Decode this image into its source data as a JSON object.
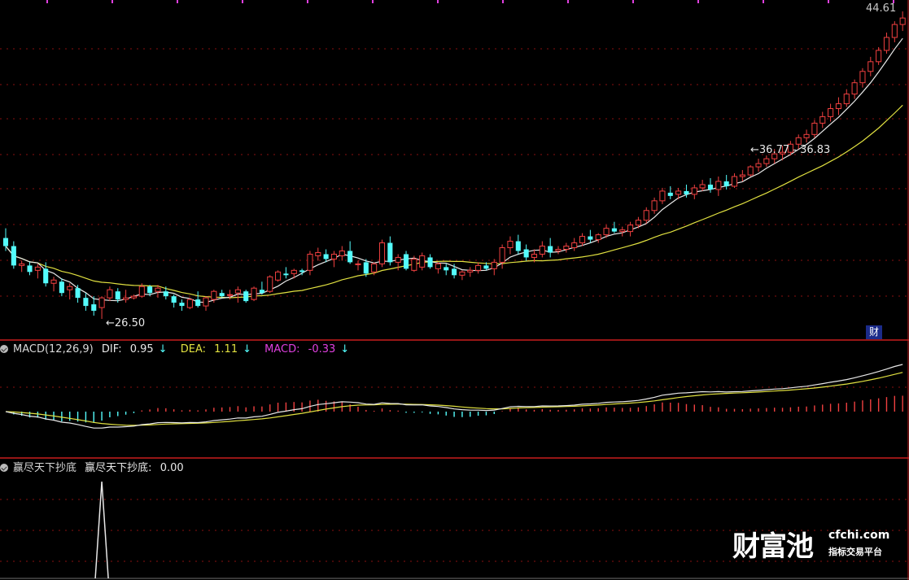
{
  "colors": {
    "up": "#f04040",
    "down": "#54fcfc",
    "ma_short": "#e8e8e8",
    "ma_long": "#e0e040",
    "dif": "#e8e8e8",
    "dea": "#e0e040",
    "grid": "#8a1010",
    "divider": "#c81e1e",
    "magenta": "#e040e0"
  },
  "price_panel": {
    "top_label": "44.61",
    "low_label": "26.50",
    "range_label": "36.77 - 36.83",
    "corner_badge": "财"
  },
  "macd_panel": {
    "name": "MACD(12,26,9)",
    "dif_label": "DIF:",
    "dif_value": "0.95",
    "dif_arrow": "↓",
    "dea_label": "DEA:",
    "dea_value": "1.11",
    "dea_arrow": "↓",
    "macd_label": "MACD:",
    "macd_value": "-0.33",
    "macd_arrow": "↓"
  },
  "signal_panel": {
    "name": "赢尽天下抄底",
    "series_label": "赢尽天下抄底:",
    "series_value": "0.00"
  },
  "brand": {
    "main": "财富池",
    "domain": "cfchi.com",
    "slogan": "指标交易平台"
  },
  "chart_data": [
    {
      "type": "candlestick",
      "y_top_label": 44.61,
      "y_low_marker": 26.5,
      "ohlc": [
        [
          30.6,
          31.2,
          29.8,
          30.1
        ],
        [
          30.1,
          30.4,
          28.7,
          28.9
        ],
        [
          28.9,
          29.2,
          28.5,
          29.0
        ],
        [
          28.9,
          29.1,
          28.3,
          28.5
        ],
        [
          28.6,
          29.0,
          28.1,
          28.8
        ],
        [
          28.7,
          29.1,
          27.6,
          27.8
        ],
        [
          27.8,
          28.2,
          27.3,
          28.0
        ],
        [
          27.9,
          28.1,
          27.0,
          27.2
        ],
        [
          27.4,
          27.8,
          26.8,
          27.6
        ],
        [
          27.5,
          27.7,
          26.6,
          26.9
        ],
        [
          26.9,
          27.2,
          26.1,
          26.4
        ],
        [
          26.5,
          27.0,
          25.8,
          26.1
        ],
        [
          26.3,
          27.0,
          25.6,
          26.9
        ],
        [
          26.9,
          27.6,
          26.7,
          27.4
        ],
        [
          27.3,
          27.5,
          26.6,
          26.8
        ],
        [
          26.8,
          27.4,
          26.6,
          26.9
        ],
        [
          26.9,
          27.1,
          26.8,
          27.0
        ],
        [
          27.0,
          27.8,
          26.9,
          27.6
        ],
        [
          27.6,
          27.7,
          27.0,
          27.2
        ],
        [
          27.3,
          27.7,
          26.9,
          27.5
        ],
        [
          27.3,
          27.6,
          26.8,
          27.0
        ],
        [
          27.0,
          27.1,
          26.3,
          26.6
        ],
        [
          26.6,
          26.8,
          26.1,
          26.4
        ],
        [
          26.3,
          26.9,
          26.2,
          26.8
        ],
        [
          26.8,
          27.3,
          26.3,
          26.4
        ],
        [
          26.4,
          27.0,
          26.1,
          26.9
        ],
        [
          26.8,
          27.4,
          26.6,
          27.3
        ],
        [
          27.2,
          27.4,
          26.9,
          27.0
        ],
        [
          27.1,
          27.4,
          26.8,
          27.1
        ],
        [
          27.2,
          27.6,
          26.6,
          27.4
        ],
        [
          27.3,
          27.4,
          26.6,
          26.7
        ],
        [
          26.8,
          27.6,
          26.7,
          27.5
        ],
        [
          27.4,
          27.9,
          27.1,
          27.2
        ],
        [
          27.3,
          28.3,
          27.2,
          28.2
        ],
        [
          28.0,
          28.6,
          27.9,
          28.5
        ],
        [
          28.4,
          28.8,
          28.1,
          28.3
        ],
        [
          28.4,
          28.7,
          28.1,
          28.6
        ],
        [
          28.6,
          28.7,
          28.3,
          28.5
        ],
        [
          28.6,
          29.8,
          28.3,
          29.6
        ],
        [
          29.5,
          30.0,
          29.2,
          29.7
        ],
        [
          29.6,
          29.9,
          29.1,
          29.3
        ],
        [
          29.3,
          29.8,
          28.8,
          29.6
        ],
        [
          29.5,
          30.1,
          29.2,
          29.8
        ],
        [
          29.8,
          30.4,
          29.0,
          29.1
        ],
        [
          29.0,
          29.2,
          28.6,
          29.0
        ],
        [
          29.1,
          29.3,
          28.2,
          28.4
        ],
        [
          28.5,
          29.1,
          28.3,
          29.0
        ],
        [
          29.0,
          30.5,
          28.8,
          30.3
        ],
        [
          30.3,
          30.7,
          28.9,
          29.1
        ],
        [
          29.1,
          29.6,
          28.6,
          29.4
        ],
        [
          29.6,
          29.8,
          28.6,
          28.7
        ],
        [
          28.6,
          29.5,
          28.5,
          29.3
        ],
        [
          28.8,
          29.7,
          28.6,
          29.5
        ],
        [
          29.4,
          29.6,
          28.7,
          28.8
        ],
        [
          28.7,
          29.1,
          28.4,
          29.0
        ],
        [
          28.8,
          29.0,
          28.3,
          28.6
        ],
        [
          28.7,
          29.0,
          28.1,
          28.3
        ],
        [
          28.3,
          28.6,
          28.0,
          28.5
        ],
        [
          28.5,
          28.8,
          28.2,
          28.6
        ],
        [
          28.6,
          29.1,
          28.4,
          28.9
        ],
        [
          28.9,
          29.1,
          28.6,
          28.7
        ],
        [
          28.7,
          29.3,
          28.3,
          29.1
        ],
        [
          29.1,
          30.2,
          28.7,
          30.0
        ],
        [
          30.0,
          30.7,
          29.6,
          30.4
        ],
        [
          30.4,
          30.8,
          29.6,
          29.8
        ],
        [
          29.9,
          30.2,
          29.2,
          29.4
        ],
        [
          29.4,
          29.9,
          29.1,
          29.6
        ],
        [
          29.6,
          30.4,
          29.4,
          30.1
        ],
        [
          30.1,
          30.6,
          29.4,
          29.7
        ],
        [
          29.8,
          30.1,
          29.6,
          29.9
        ],
        [
          29.9,
          30.3,
          29.7,
          30.1
        ],
        [
          30.0,
          30.6,
          29.8,
          30.3
        ],
        [
          30.3,
          30.9,
          30.1,
          30.7
        ],
        [
          30.7,
          31.1,
          30.3,
          30.5
        ],
        [
          30.5,
          30.9,
          30.3,
          30.8
        ],
        [
          30.8,
          31.4,
          30.6,
          31.2
        ],
        [
          31.2,
          31.6,
          30.9,
          31.0
        ],
        [
          31.0,
          31.3,
          30.7,
          31.1
        ],
        [
          31.0,
          31.6,
          30.7,
          31.4
        ],
        [
          31.4,
          31.9,
          31.2,
          31.7
        ],
        [
          31.7,
          32.5,
          31.5,
          32.3
        ],
        [
          32.3,
          33.1,
          32.1,
          32.9
        ],
        [
          32.9,
          33.7,
          32.7,
          33.5
        ],
        [
          33.4,
          33.8,
          33.0,
          33.2
        ],
        [
          33.3,
          33.7,
          33.0,
          33.5
        ],
        [
          33.5,
          33.9,
          33.1,
          33.3
        ],
        [
          33.3,
          33.9,
          33.0,
          33.7
        ],
        [
          33.7,
          34.2,
          33.5,
          33.9
        ],
        [
          33.9,
          34.3,
          33.4,
          33.6
        ],
        [
          33.6,
          34.4,
          33.2,
          34.1
        ],
        [
          34.1,
          34.5,
          33.6,
          33.8
        ],
        [
          33.8,
          34.6,
          33.7,
          34.4
        ],
        [
          34.4,
          34.8,
          34.1,
          34.5
        ],
        [
          34.5,
          35.1,
          34.4,
          35.0
        ],
        [
          35.0,
          35.5,
          34.7,
          35.2
        ],
        [
          35.2,
          35.7,
          35.0,
          35.5
        ],
        [
          35.5,
          36.1,
          35.2,
          35.8
        ],
        [
          35.8,
          36.3,
          35.4,
          35.9
        ],
        [
          35.9,
          36.6,
          35.7,
          36.4
        ],
        [
          36.4,
          37.0,
          36.1,
          36.8
        ],
        [
          36.8,
          37.3,
          36.5,
          37.0
        ],
        [
          37.0,
          37.9,
          36.8,
          37.7
        ],
        [
          37.7,
          38.4,
          37.4,
          38.1
        ],
        [
          38.1,
          38.9,
          37.8,
          38.6
        ],
        [
          38.6,
          39.3,
          38.2,
          38.9
        ],
        [
          38.9,
          39.8,
          38.7,
          39.5
        ],
        [
          39.5,
          40.4,
          39.2,
          40.2
        ],
        [
          40.2,
          41.1,
          39.9,
          40.9
        ],
        [
          40.9,
          41.8,
          40.6,
          41.5
        ],
        [
          41.5,
          42.4,
          41.3,
          42.2
        ],
        [
          42.2,
          43.3,
          42.0,
          43.0
        ],
        [
          43.0,
          44.0,
          42.7,
          43.8
        ],
        [
          43.8,
          44.61,
          43.4,
          44.2
        ]
      ],
      "ma_short": [],
      "ma_long": []
    },
    {
      "type": "bar",
      "name": "MACD(12,26,9)",
      "dif_last": 0.95,
      "dea_last": 1.11,
      "macd_last": -0.33
    },
    {
      "type": "line",
      "name": "赢尽天下抄底",
      "last": 0.0,
      "spike_at_index": 12
    }
  ]
}
